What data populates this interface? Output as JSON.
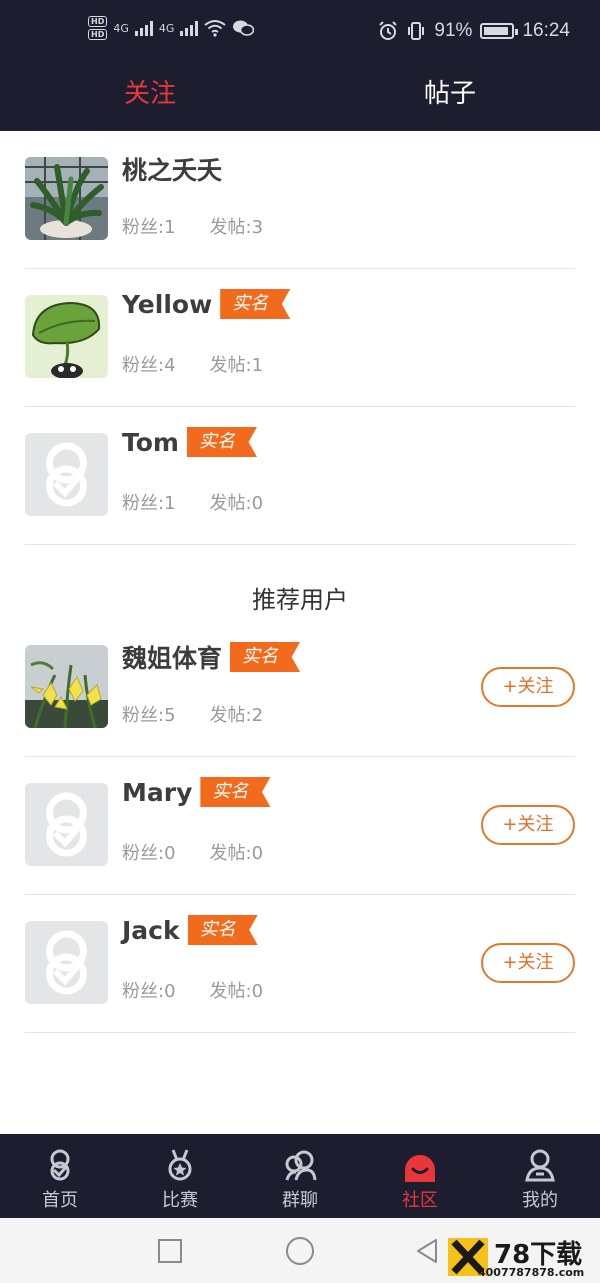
{
  "status_bar": {
    "network_1": "4G",
    "network_2": "4G",
    "battery_percent": "91%",
    "time": "16:24",
    "battery_level": 0.91
  },
  "header": {
    "tabs": [
      {
        "label": "关注",
        "active": true
      },
      {
        "label": "帖子",
        "active": false
      }
    ]
  },
  "following": [
    {
      "name": "桃之夭夭",
      "verified": false,
      "fans_label": "粉丝:1",
      "posts_label": "发帖:3",
      "avatar": "plant-photo"
    },
    {
      "name": "Yellow",
      "verified": true,
      "fans_label": "粉丝:4",
      "posts_label": "发帖:1",
      "avatar": "leaf-cartoon"
    },
    {
      "name": "Tom",
      "verified": true,
      "fans_label": "粉丝:1",
      "posts_label": "发帖:0",
      "avatar": "default-logo"
    }
  ],
  "recommended": {
    "title": "推荐用户",
    "users": [
      {
        "name": "魏姐体育",
        "verified": true,
        "fans_label": "粉丝:5",
        "posts_label": "发帖:2",
        "avatar": "lily-photo",
        "follow_label": "+关注"
      },
      {
        "name": "Mary",
        "verified": true,
        "fans_label": "粉丝:0",
        "posts_label": "发帖:0",
        "avatar": "default-logo",
        "follow_label": "+关注"
      },
      {
        "name": "Jack",
        "verified": true,
        "fans_label": "粉丝:0",
        "posts_label": "发帖:0",
        "avatar": "default-logo",
        "follow_label": "+关注"
      }
    ]
  },
  "verified_badge": "实名",
  "bottom_nav": [
    {
      "label": "首页",
      "icon": "home-logo-icon",
      "active": false
    },
    {
      "label": "比赛",
      "icon": "medal-icon",
      "active": false
    },
    {
      "label": "群聊",
      "icon": "group-chat-icon",
      "active": false
    },
    {
      "label": "社区",
      "icon": "community-icon",
      "active": true
    },
    {
      "label": "我的",
      "icon": "profile-icon",
      "active": false
    }
  ],
  "watermark": {
    "brand": "78下载",
    "site": "4007787878.com"
  },
  "colors": {
    "header_bg": "#1c1d2f",
    "accent_red": "#e8363a",
    "badge_orange": "#f26a1b",
    "follow_orange": "#e0712a"
  }
}
